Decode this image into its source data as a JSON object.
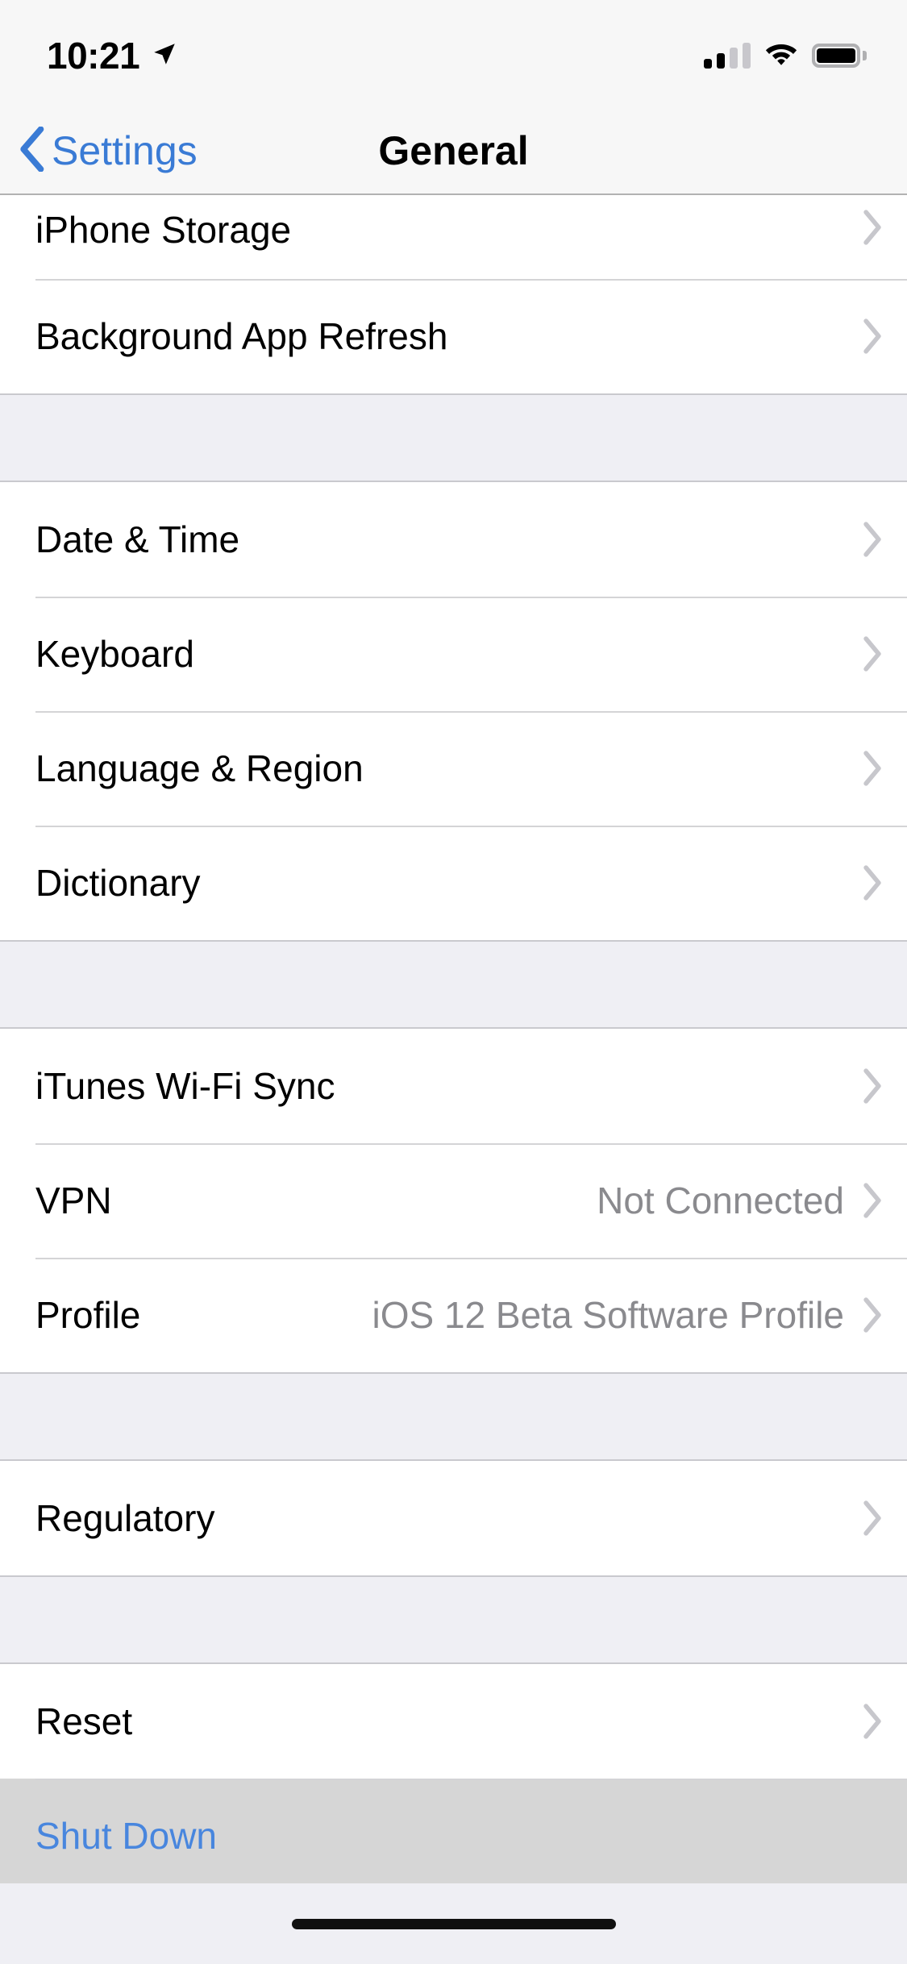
{
  "status_bar": {
    "time": "10:21",
    "location_icon": "location-arrow-icon",
    "signal_icon": "cellular-signal-icon",
    "signal_bars_filled": 2,
    "signal_bars_total": 4,
    "wifi_icon": "wifi-icon",
    "battery_icon": "battery-full-icon"
  },
  "nav": {
    "back_icon": "chevron-left-icon",
    "back_label": "Settings",
    "title": "General"
  },
  "colors": {
    "accent_blue": "#3A7BD5",
    "destructive_blue": "#4886DE",
    "value_gray": "#8A8A8E",
    "chevron_gray": "#C7C7CC",
    "group_background": "#EFEFF4",
    "row_background": "#FFFFFF",
    "highlight_background": "#D6D6D6"
  },
  "sections": [
    {
      "rows": [
        {
          "label": "iPhone Storage",
          "value": "",
          "chevron": true,
          "clipped": true,
          "style": "default"
        },
        {
          "label": "Background App Refresh",
          "value": "",
          "chevron": true,
          "clipped": false,
          "style": "default"
        }
      ]
    },
    {
      "rows": [
        {
          "label": "Date & Time",
          "value": "",
          "chevron": true,
          "clipped": false,
          "style": "default"
        },
        {
          "label": "Keyboard",
          "value": "",
          "chevron": true,
          "clipped": false,
          "style": "default"
        },
        {
          "label": "Language & Region",
          "value": "",
          "chevron": true,
          "clipped": false,
          "style": "default"
        },
        {
          "label": "Dictionary",
          "value": "",
          "chevron": true,
          "clipped": false,
          "style": "default"
        }
      ]
    },
    {
      "rows": [
        {
          "label": "iTunes Wi-Fi Sync",
          "value": "",
          "chevron": true,
          "clipped": false,
          "style": "default"
        },
        {
          "label": "VPN",
          "value": "Not Connected",
          "chevron": true,
          "clipped": false,
          "style": "default"
        },
        {
          "label": "Profile",
          "value": "iOS 12 Beta Software Profile",
          "chevron": true,
          "clipped": false,
          "style": "default"
        }
      ]
    },
    {
      "rows": [
        {
          "label": "Regulatory",
          "value": "",
          "chevron": true,
          "clipped": false,
          "style": "default"
        }
      ]
    },
    {
      "rows": [
        {
          "label": "Reset",
          "value": "",
          "chevron": true,
          "clipped": false,
          "style": "default"
        },
        {
          "label": "Shut Down",
          "value": "",
          "chevron": false,
          "clipped": false,
          "style": "destructive"
        }
      ]
    }
  ],
  "home_indicator": "home-indicator-bar"
}
